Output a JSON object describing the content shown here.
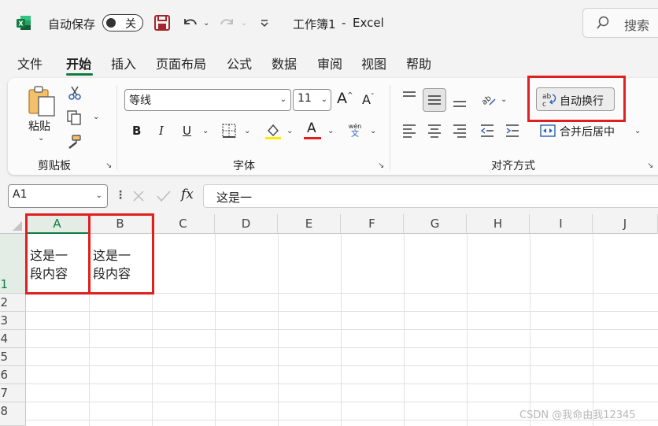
{
  "titlebar": {
    "autosave_label": "自动保存",
    "autosave_state": "关",
    "doc_title": "工作簿1",
    "separator": "-",
    "app_name": "Excel",
    "search_placeholder": "搜索"
  },
  "menu": [
    "文件",
    "开始",
    "插入",
    "页面布局",
    "公式",
    "数据",
    "审阅",
    "视图",
    "帮助"
  ],
  "ribbon": {
    "clipboard": {
      "paste_label": "粘贴",
      "group_label": "剪贴板"
    },
    "font": {
      "font_name": "等线",
      "font_size": "11",
      "bold": "B",
      "italic": "I",
      "underline": "U",
      "font_color_glyph": "A",
      "grow_glyph": "A",
      "shrink_glyph": "A",
      "phonetic_top": "wén",
      "phonetic_bottom": "文",
      "group_label": "字体"
    },
    "alignment": {
      "wrap_text": "自动换行",
      "merge_center": "合并后居中",
      "group_label": "对齐方式"
    }
  },
  "formula_bar": {
    "name_box": "A1",
    "fx": "fx",
    "content": "这是一"
  },
  "grid": {
    "columns": [
      "A",
      "B",
      "C",
      "D",
      "E",
      "F",
      "G",
      "H",
      "I",
      "J"
    ],
    "rows": [
      "1",
      "2",
      "3",
      "4",
      "5",
      "6",
      "7",
      "8"
    ],
    "A1": [
      "这是一",
      "段内容"
    ],
    "B1": [
      "这是一",
      "段内容"
    ]
  },
  "watermark": "CSDN @我命由我12345",
  "colors": {
    "accent": "#107c41",
    "highlight": "#e02020",
    "excel_green": "#1d6f42"
  }
}
